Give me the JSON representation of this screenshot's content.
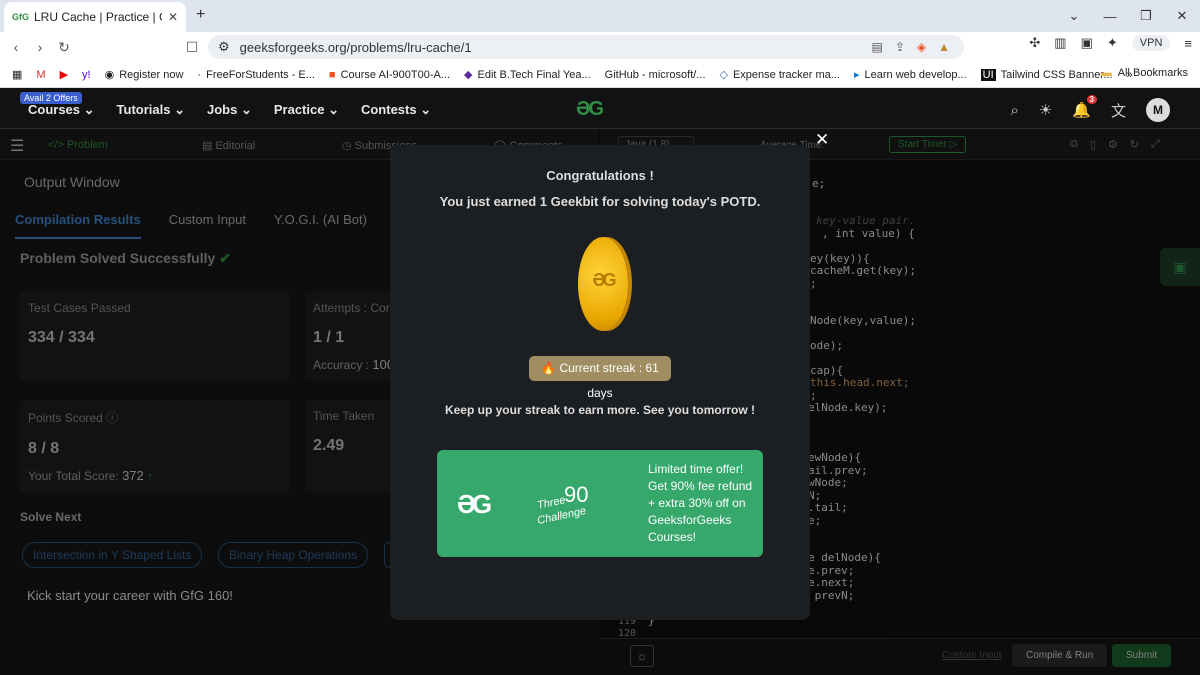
{
  "browser": {
    "tab_title": "LRU Cache | Practice | GeeksforGeeks",
    "tab_favicon": "GfG",
    "url": "geeksforgeeks.org/problems/lru-cache/1",
    "vpn": "VPN",
    "bookmarks": [
      "Register now",
      "FreeForStudents - E...",
      "Course AI-900T00-A...",
      "Edit B.Tech Final Yea...",
      "GitHub - microsoft/...",
      "Expense tracker ma...",
      "Learn web develop...",
      "Tailwind CSS Banner..."
    ],
    "all_bookmarks": "All Bookmarks"
  },
  "gfg_header": {
    "offer_badge": "Avail 2 Offers",
    "menu": [
      "Courses",
      "Tutorials",
      "Jobs",
      "Practice",
      "Contests"
    ],
    "logo": "ƏG",
    "notification_count": "3",
    "avatar_letter": "M"
  },
  "problem_tabs": [
    "Problem",
    "Editorial",
    "Submissions",
    "Comments"
  ],
  "output": {
    "title": "Output Window",
    "tabs": [
      "Compilation Results",
      "Custom Input",
      "Y.O.G.I. (AI Bot)"
    ],
    "status": "Problem Solved Successfully",
    "cards": {
      "test_cases_label": "Test Cases Passed",
      "test_cases_value": "334 / 334",
      "attempts_label": "Attempts : Corr",
      "attempts_value": "1 / 1",
      "accuracy_label": "Accuracy : ",
      "accuracy_value": "100",
      "points_label": "Points Scored",
      "points_value": "8 / 8",
      "total_label": "Your Total Score: ",
      "total_value": "372",
      "time_label": "Time Taken",
      "time_value": "2.49"
    },
    "solve_next_title": "Solve Next",
    "solve_next": [
      "Intersection in Y Shaped Lists",
      "Binary Heap Operations"
    ],
    "kick": "Kick start your career with GfG 160!"
  },
  "editor": {
    "language": "Java (1.8)",
    "avg_time": "Average Time: ",
    "timer": "Start Timer",
    "line_numbers": [
      "119",
      "120"
    ],
    "code_lines": [
      "e;",
      "key-value pair.",
      ", int value) {",
      "ey(key)){",
      "cacheM.get(key);",
      ";",
      "Node(key,value);",
      "ode);",
      "cap){",
      "this.head.next;",
      ";",
      "elNode.key);",
      "ewNode){",
      "ail.prev;",
      "wNode;",
      "N;",
      ".tail;",
      "e;",
      "e delNode){",
      "e.prev;",
      "e.next;",
      " prevN;",
      "}"
    ],
    "custom_input": "Custom Input",
    "compile_run": "Compile & Run",
    "submit": "Submit"
  },
  "modal": {
    "title": "Congratulations !",
    "message": "You just earned 1 Geekbit for solving today's POTD.",
    "coin_logo": "ƏG",
    "streak": "Current streak : 61 days",
    "encourage": "Keep up your streak to earn more. See you tomorrow !",
    "promo": {
      "logo": "ƏG",
      "three": "Three",
      "ninety": "90",
      "challenge": "Challenge",
      "text": "Limited time offer! Get 90% fee refund + extra 30% off on GeeksforGeeks Courses!"
    }
  }
}
